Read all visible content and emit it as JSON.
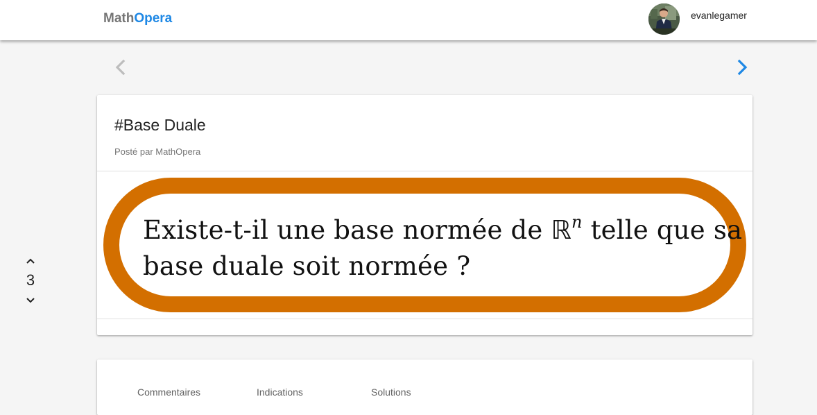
{
  "header": {
    "logo_part1": "Math",
    "logo_part2": "Opera",
    "username": "evanlegamer",
    "accent_color": "#1e88e5"
  },
  "navigation": {
    "prev_icon": "chevron-left-icon",
    "next_icon": "chevron-right-icon"
  },
  "vote": {
    "up_icon": "chevron-up-icon",
    "count": "3",
    "down_icon": "chevron-down-icon"
  },
  "post": {
    "title": "#Base Duale",
    "subtitle": "Posté par MathOpera",
    "problem_before": "Existe-t-il une base normée de ",
    "problem_symbol": "ℝ",
    "problem_exponent": "n",
    "problem_after": " telle que sa",
    "problem_line2": "base duale soit normée ?",
    "frame_color": "#d36f00"
  },
  "tabs": [
    {
      "label": "Commentaires"
    },
    {
      "label": "Indications"
    },
    {
      "label": "Solutions"
    }
  ]
}
